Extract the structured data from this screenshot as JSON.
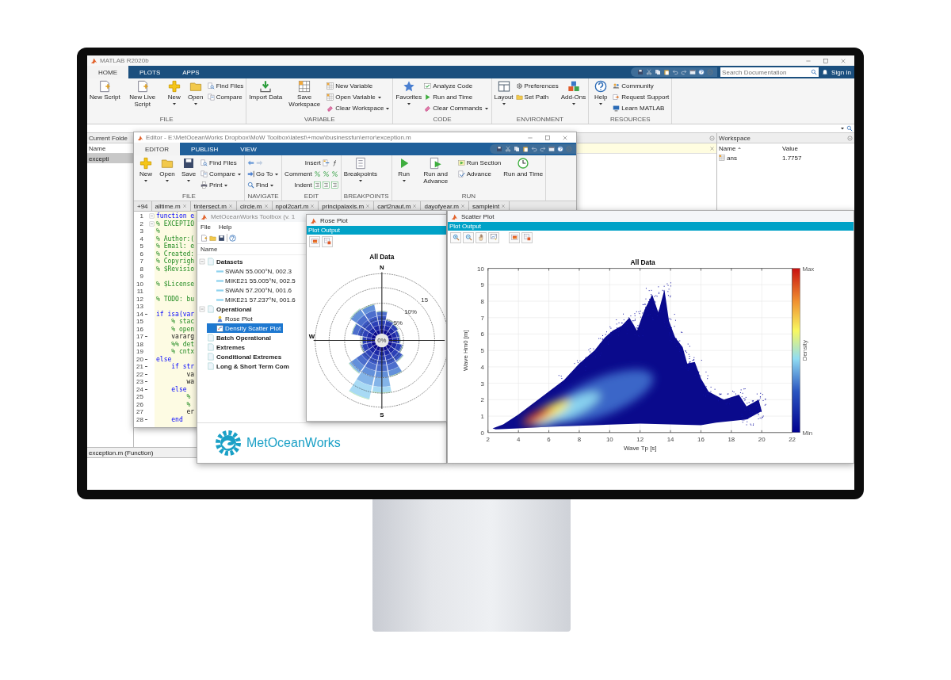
{
  "matlab": {
    "title": "MATLAB R2020b",
    "tabs": [
      {
        "label": "HOME",
        "selected": true
      },
      {
        "label": "PLOTS",
        "selected": false
      },
      {
        "label": "APPS",
        "selected": false
      }
    ],
    "search": {
      "placeholder": "Search Documentation"
    },
    "sign_in": "Sign In",
    "ribbon": [
      {
        "label": "FILE",
        "items": [
          {
            "label": "New Script",
            "kind": "large",
            "dropdown": false
          },
          {
            "label": "New Live Script",
            "kind": "large",
            "dropdown": false
          },
          {
            "label": "New",
            "kind": "large",
            "dropdown": true
          },
          {
            "label": "Open",
            "kind": "large",
            "dropdown": true
          },
          {
            "label": "Find Files",
            "kind": "small",
            "dropdown": false
          },
          {
            "label": "Compare",
            "kind": "small",
            "dropdown": false
          }
        ]
      },
      {
        "label": "VARIABLE",
        "items": [
          {
            "label": "Import Data",
            "kind": "large",
            "dropdown": false
          },
          {
            "label": "Save Workspace",
            "kind": "large",
            "dropdown": false
          },
          {
            "label": "New Variable",
            "kind": "small",
            "dropdown": false
          },
          {
            "label": "Open Variable",
            "kind": "small",
            "dropdown": true
          },
          {
            "label": "Clear Workspace",
            "kind": "small",
            "dropdown": true
          }
        ]
      },
      {
        "label": "CODE",
        "items": [
          {
            "label": "Favorites",
            "kind": "large",
            "dropdown": true
          },
          {
            "label": "Analyze Code",
            "kind": "small",
            "dropdown": false
          },
          {
            "label": "Run and Time",
            "kind": "small",
            "dropdown": false
          },
          {
            "label": "Clear Commands",
            "kind": "small",
            "dropdown": true
          }
        ]
      },
      {
        "label": "ENVIRONMENT",
        "items": [
          {
            "label": "Layout",
            "kind": "large",
            "dropdown": true
          },
          {
            "label": "Preferences",
            "kind": "small",
            "dropdown": false
          },
          {
            "label": "Set Path",
            "kind": "small",
            "dropdown": false
          },
          {
            "label": "Add-Ons",
            "kind": "large",
            "dropdown": true
          }
        ]
      },
      {
        "label": "RESOURCES",
        "items": [
          {
            "label": "Help",
            "kind": "large",
            "dropdown": true
          },
          {
            "label": "Community",
            "kind": "small",
            "dropdown": false
          },
          {
            "label": "Request Support",
            "kind": "small",
            "dropdown": false
          },
          {
            "label": "Learn MATLAB",
            "kind": "small",
            "dropdown": false
          }
        ]
      }
    ],
    "current_folder": {
      "title": "Current Folde",
      "column": "Name",
      "files": [
        {
          "name": "excepti",
          "selected": true
        }
      ]
    },
    "workspace": {
      "title": "Workspace",
      "columns": [
        "Name",
        "Value"
      ],
      "rows": [
        {
          "name": "ans",
          "value": "1.7757"
        }
      ]
    },
    "status": "exception.m (Function)"
  },
  "editor": {
    "title": "Editor - E:\\MetOceanWorks Dropbox\\MoW Toolbox\\latest\\+mow\\businessfun\\error\\exception.m",
    "tabs": [
      {
        "label": "EDITOR",
        "selected": true
      },
      {
        "label": "PUBLISH",
        "selected": false
      },
      {
        "label": "VIEW",
        "selected": false
      }
    ],
    "ribbon": [
      {
        "label": "FILE",
        "items": [
          {
            "label": "New",
            "kind": "large",
            "dropdown": true
          },
          {
            "label": "Open",
            "kind": "large",
            "dropdown": true
          },
          {
            "label": "Save",
            "kind": "large",
            "dropdown": true
          },
          {
            "label": "Find Files",
            "kind": "small",
            "dropdown": false
          },
          {
            "label": "Compare",
            "kind": "small",
            "dropdown": true
          },
          {
            "label": "Print",
            "kind": "small",
            "dropdown": true
          }
        ]
      },
      {
        "label": "NAVIGATE",
        "items": [
          {
            "kind": "nav"
          },
          {
            "label": "Go To",
            "kind": "small",
            "dropdown": true
          },
          {
            "label": "Find",
            "kind": "small",
            "dropdown": true
          }
        ]
      },
      {
        "label": "EDIT",
        "items": [
          {
            "label": "Insert",
            "kind": "row"
          },
          {
            "label": "Comment",
            "kind": "row"
          },
          {
            "label": "Indent",
            "kind": "row"
          }
        ]
      },
      {
        "label": "BREAKPOINTS",
        "items": [
          {
            "label": "Breakpoints",
            "kind": "large",
            "dropdown": true
          }
        ]
      },
      {
        "label": "RUN",
        "items": [
          {
            "label": "Run",
            "kind": "large",
            "dropdown": true
          },
          {
            "label": "Run and Advance",
            "kind": "large",
            "dropdown": false
          },
          {
            "label": "Run Section",
            "kind": "small",
            "dropdown": false
          },
          {
            "label": "Advance",
            "kind": "small",
            "dropdown": false
          },
          {
            "label": "Run and Time",
            "kind": "large",
            "dropdown": false
          }
        ]
      }
    ],
    "tab_list": "+94",
    "file_tabs": [
      "alltime.m",
      "tintersect.m",
      "circle.m",
      "npol2cart.m",
      "principalaxis.m",
      "cart2naut.m",
      "dayofyear.m",
      "sampleint"
    ],
    "lines": [
      {
        "number": "1",
        "text": "function e",
        "kind": "keyword",
        "fold": true,
        "executable": false
      },
      {
        "number": "2",
        "text": "% EXCEPTIO",
        "kind": "comment",
        "fold": true,
        "executable": false
      },
      {
        "number": "3",
        "text": "%",
        "kind": "comment",
        "fold": false,
        "executable": false
      },
      {
        "number": "4",
        "text": "% Author:(",
        "kind": "comment",
        "fold": false,
        "executable": false
      },
      {
        "number": "5",
        "text": "% Email: e",
        "kind": "comment",
        "fold": false,
        "executable": false
      },
      {
        "number": "6",
        "text": "% Created:",
        "kind": "comment",
        "fold": false,
        "executable": false
      },
      {
        "number": "7",
        "text": "% Copyrigh",
        "kind": "comment",
        "fold": false,
        "executable": false
      },
      {
        "number": "8",
        "text": "% $Revisio",
        "kind": "comment",
        "fold": false,
        "executable": false
      },
      {
        "number": "9",
        "kind": "code",
        "fold": false,
        "executable": false
      },
      {
        "number": "10",
        "text": "% $License",
        "kind": "comment",
        "fold": false,
        "executable": false
      },
      {
        "number": "11",
        "kind": "code",
        "fold": false,
        "executable": false
      },
      {
        "number": "12",
        "text": "% TODO: bu",
        "kind": "comment",
        "fold": false,
        "executable": false
      },
      {
        "number": "13",
        "kind": "code",
        "fold": false,
        "executable": false
      },
      {
        "number": "14",
        "text": "if isa(var",
        "kind": "keyword",
        "fold": false,
        "executable": true
      },
      {
        "number": "15",
        "text": "    % stac",
        "kind": "comment",
        "fold": false,
        "executable": false
      },
      {
        "number": "16",
        "text": "    % open",
        "kind": "comment",
        "fold": false,
        "executable": false
      },
      {
        "number": "17",
        "text": "    vararg",
        "kind": "code",
        "fold": false,
        "executable": true
      },
      {
        "number": "18",
        "text": "    %% det",
        "kind": "comment",
        "fold": false,
        "executable": false
      },
      {
        "number": "19",
        "text": "    % cntx",
        "kind": "comment",
        "fold": false,
        "executable": false
      },
      {
        "number": "20",
        "text": "else",
        "kind": "keyword",
        "fold": false,
        "executable": true
      },
      {
        "number": "21",
        "text": "    if str",
        "kind": "keyword",
        "fold": false,
        "executable": true
      },
      {
        "number": "22",
        "text": "        va",
        "kind": "code",
        "fold": false,
        "executable": true
      },
      {
        "number": "23",
        "text": "        wa",
        "kind": "code",
        "fold": false,
        "executable": true
      },
      {
        "number": "24",
        "text": "    else",
        "kind": "keyword",
        "fold": false,
        "executable": true
      },
      {
        "number": "25",
        "text": "        %",
        "kind": "comment",
        "fold": false,
        "executable": false
      },
      {
        "number": "26",
        "text": "        %",
        "kind": "comment",
        "fold": false,
        "executable": false
      },
      {
        "number": "27",
        "text": "        er",
        "kind": "code",
        "fold": false,
        "executable": false
      },
      {
        "number": "28",
        "text": "    end",
        "kind": "keyword",
        "fold": false,
        "executable": true
      }
    ]
  },
  "toolbox": {
    "title": "MetOceanWorks Toolbox (v. 1",
    "menu": [
      "File",
      "Help"
    ],
    "tree_header": "Name",
    "tree": [
      {
        "label": "Datasets",
        "kind": "category",
        "expanded": true,
        "selected": false,
        "children": [
          {
            "label": "SWAN 55.000°N, 002.3",
            "kind": "dataset",
            "selected": false
          },
          {
            "label": "MIKE21 55.005°N, 002.5",
            "kind": "dataset",
            "selected": false
          },
          {
            "label": "SWAN 57.200°N, 001.6",
            "kind": "dataset",
            "selected": false
          },
          {
            "label": "MIKE21 57.237°N, 001.6",
            "kind": "dataset",
            "selected": false
          }
        ]
      },
      {
        "label": "Operational",
        "kind": "category",
        "expanded": true,
        "selected": false,
        "children": [
          {
            "label": "Rose Plot",
            "kind": "rose_plot",
            "selected": false
          },
          {
            "label": "Density Scatter Plot",
            "kind": "scatter_plot",
            "selected": true
          }
        ]
      },
      {
        "label": "Batch Operational",
        "kind": "category",
        "expanded": false,
        "selected": false
      },
      {
        "label": "Extremes",
        "kind": "category",
        "expanded": false,
        "selected": false
      },
      {
        "label": "Conditional Extremes",
        "kind": "category",
        "expanded": false,
        "selected": false
      },
      {
        "label": "Long & Short Term Com",
        "kind": "category",
        "expanded": false,
        "selected": false
      }
    ],
    "logo": "MetOceanWorks"
  },
  "rose_window": {
    "title": "Rose Plot",
    "band": "Plot Output",
    "plot": {
      "title": "All Data",
      "directions": [
        "N",
        "W",
        "S"
      ],
      "rings": [
        "0%",
        "5%",
        "10%",
        "15"
      ]
    }
  },
  "scatter_window": {
    "title": "Scatter Plot",
    "band": "Plot Output",
    "plot": {
      "title": "All Data",
      "x_label": "Wave Tp [s]",
      "y_label": "Wave Hm0 [m]",
      "x_ticks": [
        "2",
        "4",
        "6",
        "8",
        "10",
        "12",
        "14",
        "16",
        "18",
        "20",
        "22"
      ],
      "y_ticks": [
        "10",
        "9",
        "8",
        "7",
        "6",
        "5",
        "4",
        "3",
        "2",
        "1",
        "0"
      ],
      "colorbar": {
        "max": "Max",
        "min": "Min",
        "label": "Density"
      }
    }
  }
}
